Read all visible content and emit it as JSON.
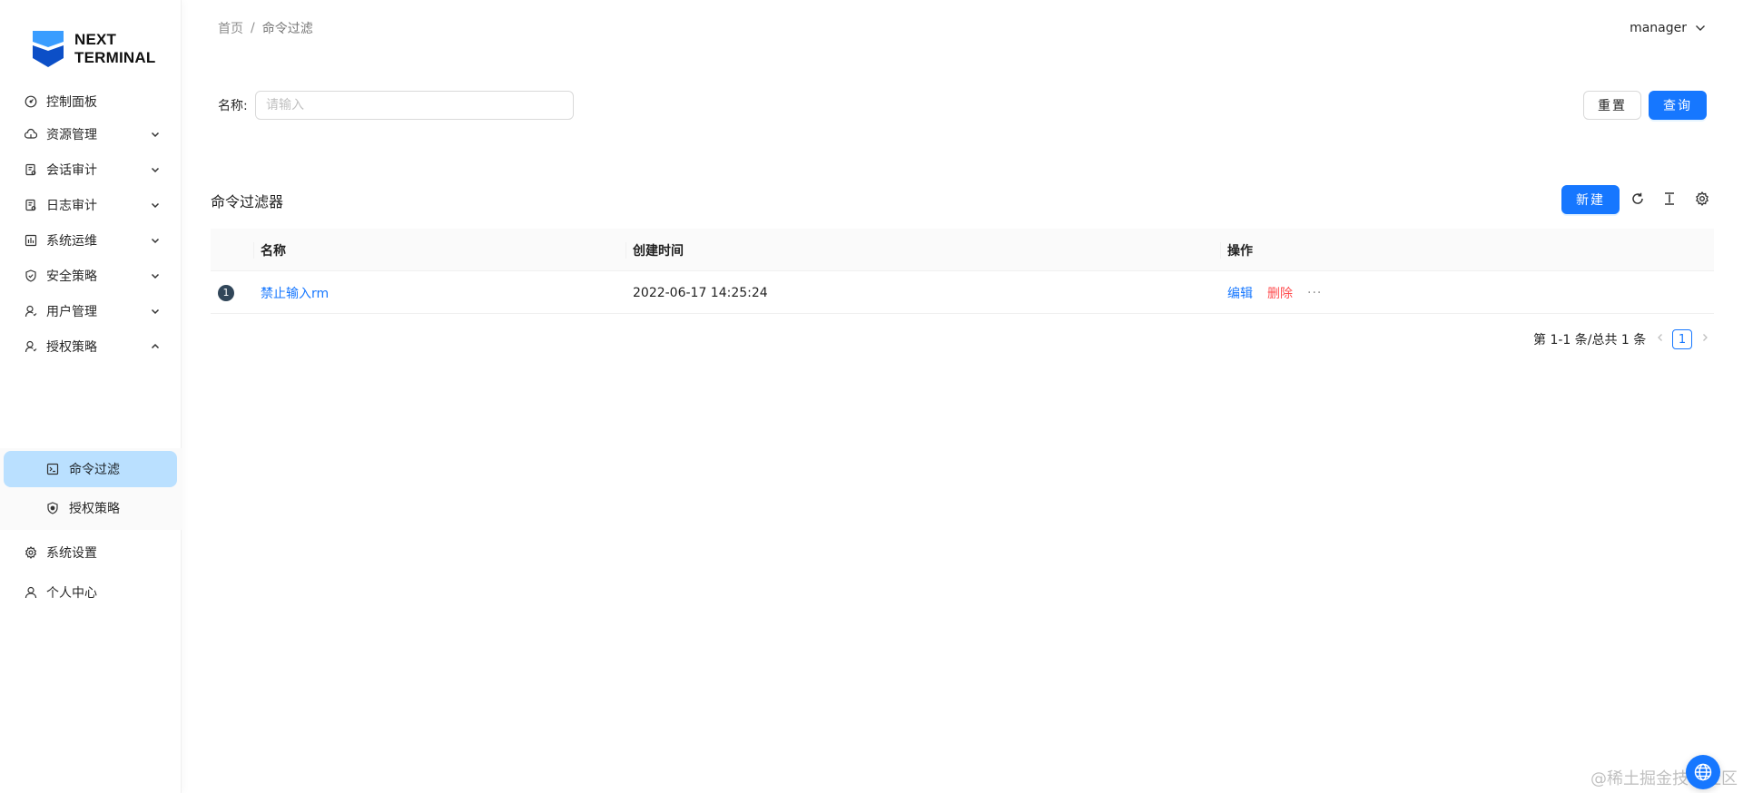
{
  "colors": {
    "primary": "#1677ff",
    "danger": "#ff4d4f",
    "activeMenuBg": "#bae0ff"
  },
  "logo": {
    "line1": "NEXT",
    "line2": "TERMINAL"
  },
  "sidebar": {
    "items": [
      {
        "label": "控制面板",
        "icon": "dashboard-icon"
      },
      {
        "label": "资源管理",
        "icon": "cloud-icon",
        "arrow": "chevron-down-icon"
      },
      {
        "label": "会话审计",
        "icon": "audit-icon",
        "arrow": "chevron-down-icon"
      },
      {
        "label": "日志审计",
        "icon": "audit-icon",
        "arrow": "chevron-down-icon"
      },
      {
        "label": "系统运维",
        "icon": "ops-icon",
        "arrow": "chevron-down-icon"
      },
      {
        "label": "安全策略",
        "icon": "shield-check-icon",
        "arrow": "chevron-down-icon"
      },
      {
        "label": "用户管理",
        "icon": "user-icon",
        "arrow": "chevron-down-icon"
      },
      {
        "label": "授权策略",
        "icon": "user-icon",
        "arrow": "chevron-up-icon"
      },
      {
        "label": "系统设置",
        "icon": "gear-icon"
      },
      {
        "label": "个人中心",
        "icon": "user-icon"
      }
    ],
    "subitems": [
      {
        "label": "命令过滤",
        "icon": "terminal-icon",
        "active": true
      },
      {
        "label": "授权策略",
        "icon": "safety-icon",
        "active": false
      }
    ]
  },
  "header": {
    "breadcrumb": [
      "首页",
      "命令过滤"
    ],
    "separator": "/",
    "user": "manager"
  },
  "search": {
    "label": "名称:",
    "placeholder": "请输入",
    "value": "",
    "reset_label": "重置",
    "query_label": "查询"
  },
  "card": {
    "title": "命令过滤器",
    "new_label": "新建",
    "tools": [
      "reload-icon",
      "column-height-icon",
      "setting-icon"
    ]
  },
  "table": {
    "columns": [
      "名称",
      "创建时间",
      "操作"
    ],
    "rows": [
      {
        "index": "1",
        "name": "禁止输入rm",
        "created": "2022-06-17 14:25:24",
        "actions": {
          "edit": "编辑",
          "delete": "删除",
          "more": "···"
        }
      }
    ]
  },
  "pagination": {
    "total_text": "第 1-1 条/总共 1 条",
    "current_page": "1"
  },
  "watermark": "@稀土掘金技术社区"
}
